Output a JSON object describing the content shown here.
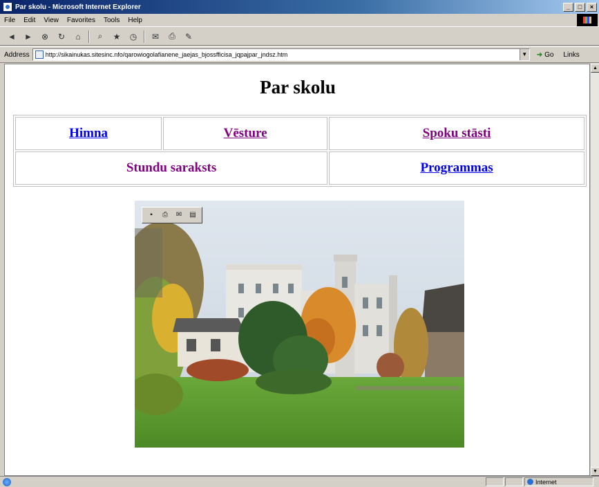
{
  "window": {
    "title": "Par skolu - Microsoft Internet Explorer",
    "minimize": "_",
    "maximize": "□",
    "close": "×"
  },
  "menu": {
    "items": [
      "File",
      "Edit",
      "View",
      "Favorites",
      "Tools",
      "Help"
    ]
  },
  "toolbar": {
    "buttons": [
      "back-icon",
      "forward-icon",
      "stop-icon",
      "refresh-icon",
      "home-icon",
      "search-icon",
      "favorites-icon",
      "history-icon",
      "mail-icon",
      "print-icon",
      "edit-icon"
    ]
  },
  "address": {
    "label": "Address",
    "url": "http://sikainukas.sitesinc.nfo/qarowiogolafianene_jaejas_bjossfficisa_jqpajpar_jndsz.htm",
    "go_label": "Go",
    "links_label": "Links"
  },
  "page": {
    "title": "Par skolu",
    "nav": {
      "himna": "Himna",
      "vesture": "Vēsture",
      "spoku": "Spoku stāsti",
      "stundu": "Stundu saraksts",
      "programmas": "Programmas"
    }
  },
  "status": {
    "text": "",
    "zone": "Internet"
  },
  "colors": {
    "link_unvisited": "#0000ee",
    "link_visited": "#800080",
    "titlebar": "#0a246a"
  }
}
